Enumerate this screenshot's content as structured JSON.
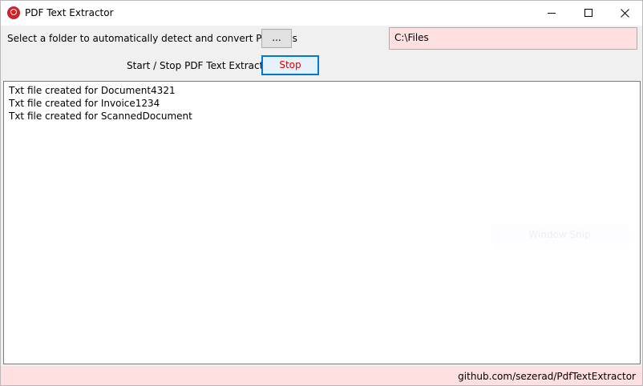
{
  "window": {
    "title": "PDF Text Extractor",
    "icon": "pdf-app-icon",
    "controls": [
      "minimize-icon",
      "maximize-icon",
      "close-icon"
    ]
  },
  "folder_row": {
    "label": "Select a folder to automatically detect and convert PDF files",
    "browse_label": "...",
    "path_value": "C:\\Files"
  },
  "control_row": {
    "label": "Start / Stop PDF Text Extractor",
    "toggle_label": "Stop"
  },
  "log": {
    "lines": [
      "Txt file created for Document4321",
      "Txt file created for Invoice1234",
      "Txt file created for ScannedDocument"
    ]
  },
  "overlay": {
    "snap_hint": "Window Snip"
  },
  "footer": {
    "link_text": "github.com/sezerad/PdfTextExtractor"
  },
  "colors": {
    "accent": "#0078d7",
    "stop_text": "#e00000",
    "pink_background": "#ffe0e0",
    "app_icon": "#d32027"
  }
}
